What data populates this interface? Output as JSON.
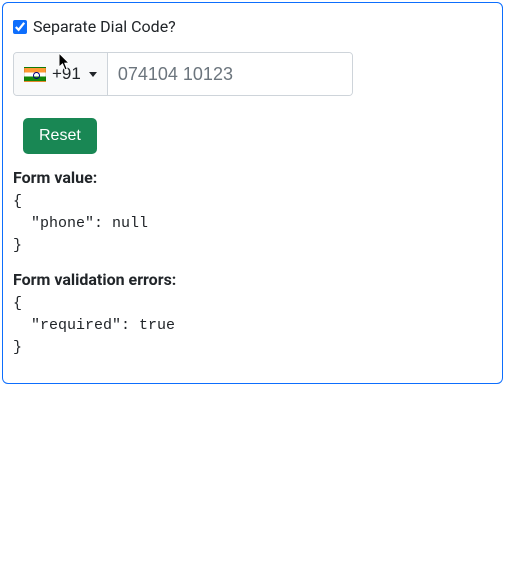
{
  "checkbox": {
    "label": "Separate Dial Code?",
    "checked": true
  },
  "phone": {
    "dial_code": "+91",
    "flag": "india-flag",
    "placeholder": "074104 10123",
    "value": ""
  },
  "buttons": {
    "reset": "Reset"
  },
  "sections": {
    "form_value_label": "Form value:",
    "form_value_json": "{\n  \"phone\": null\n}",
    "form_errors_label": "Form validation errors:",
    "form_errors_json": "{\n  \"required\": true\n}"
  }
}
